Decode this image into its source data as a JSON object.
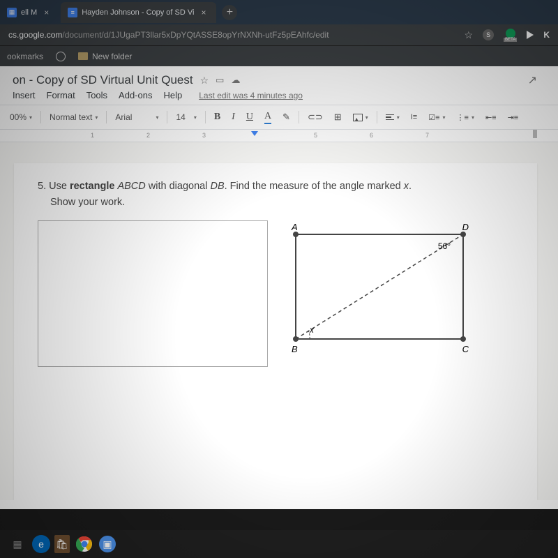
{
  "browser": {
    "tabs": [
      {
        "label": "ell M"
      },
      {
        "label": "Hayden Johnson - Copy of SD Vi"
      }
    ],
    "tab_close": "×",
    "new_tab": "+",
    "url_host": "cs.google.com",
    "url_path": "/document/d/1JUgaPT3llar5xDpYQtASSE8opYrNXNh-utFz5pEAhfc/edit",
    "star": "☆",
    "s_badge": "S",
    "beta": "BETA",
    "k_right": "K"
  },
  "bookmarks": {
    "label_left": "ookmarks",
    "new_folder": "New folder"
  },
  "doc": {
    "title": "on - Copy of SD Virtual Unit Quest",
    "star": "☆",
    "move": "▭",
    "cloud": "☁",
    "trend": "↗",
    "menu": {
      "insert": "Insert",
      "format": "Format",
      "tools": "Tools",
      "addons": "Add-ons",
      "help": "Help",
      "last_edit": "Last edit was 4 minutes ago"
    },
    "toolbar": {
      "zoom": "00%",
      "style": "Normal text",
      "font": "Arial",
      "size": "14",
      "B": "B",
      "I": "I",
      "U": "U",
      "A": "A",
      "pen": "✎",
      "link": "⊂⊃",
      "comment": "⊞"
    },
    "ruler": {
      "n1": "1",
      "n2": "2",
      "n3": "3",
      "n5": "5",
      "n6": "6",
      "n7": "7"
    }
  },
  "problem": {
    "num": "5.",
    "lead": "Use ",
    "rect": "rectangle",
    "mid1": " ",
    "abcd": "ABCD",
    "mid2": " with diagonal ",
    "db": "DB",
    "tail": ". Find the measure of the angle marked ",
    "xvar": "x",
    "period": ".",
    "line2": "Show your work.",
    "labelA": "A",
    "labelB": "B",
    "labelC": "C",
    "labelD": "D",
    "angle56": "56°",
    "anglex": "x"
  }
}
